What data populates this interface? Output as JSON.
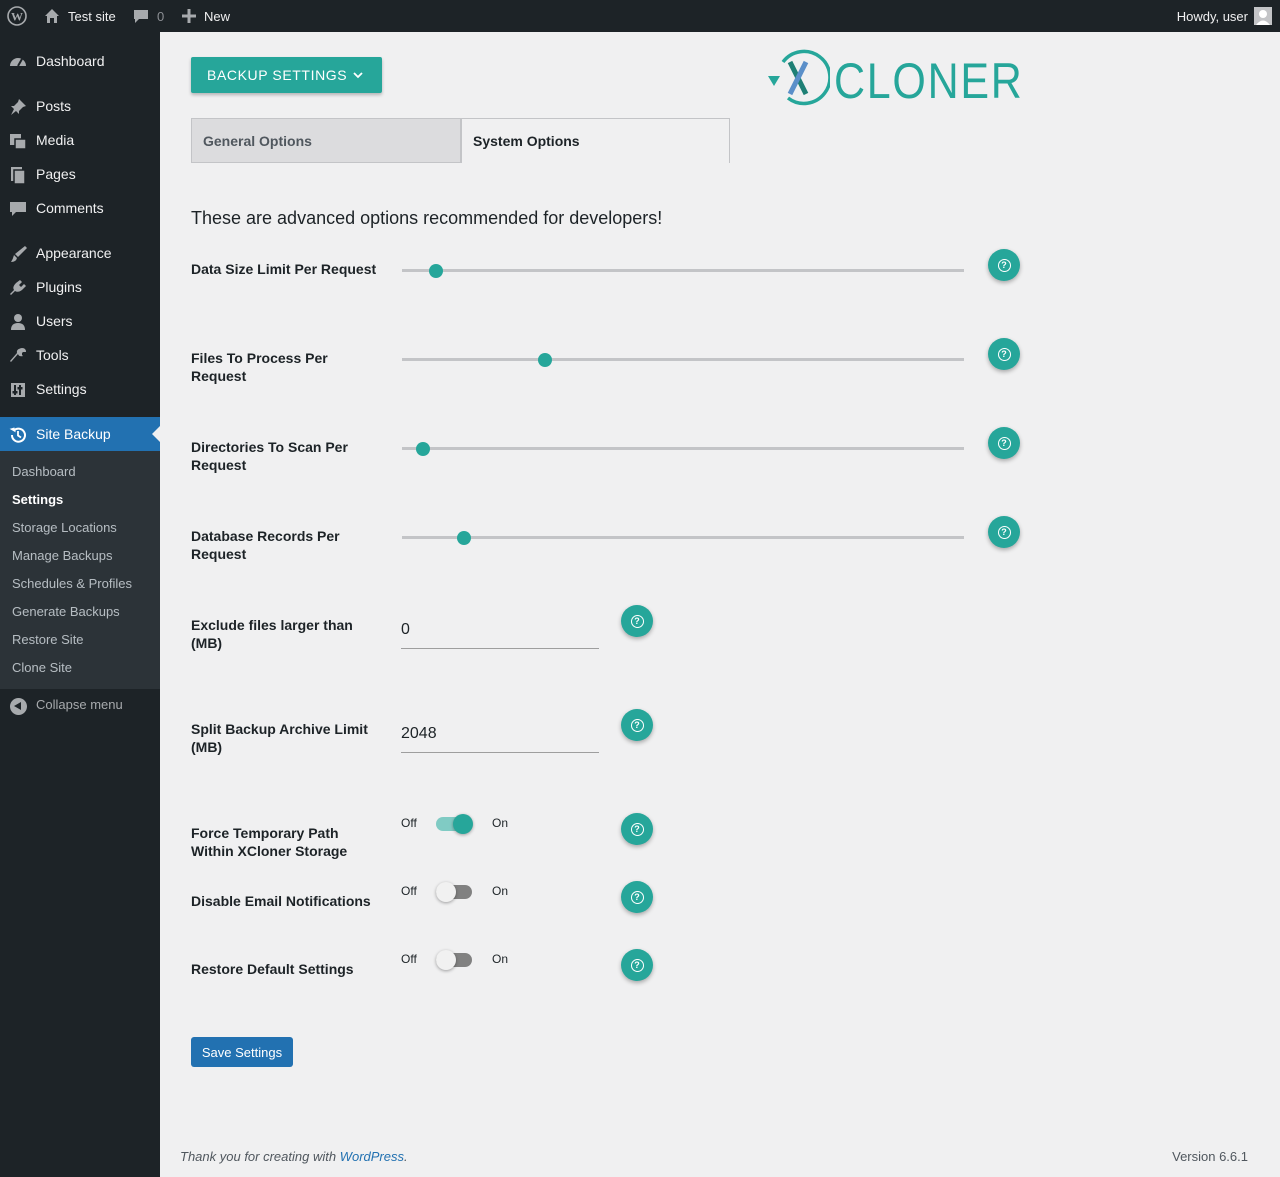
{
  "adminbar": {
    "site_name": "Test site",
    "comments_count": "0",
    "new_label": "New",
    "howdy": "Howdy, user"
  },
  "sidebar": {
    "items": [
      {
        "label": "Dashboard",
        "icon": "dashboard-icon"
      },
      {
        "label": "Posts",
        "icon": "pin-icon"
      },
      {
        "label": "Media",
        "icon": "media-icon"
      },
      {
        "label": "Pages",
        "icon": "pages-icon"
      },
      {
        "label": "Comments",
        "icon": "comments-icon"
      },
      {
        "label": "Appearance",
        "icon": "brush-icon"
      },
      {
        "label": "Plugins",
        "icon": "plug-icon"
      },
      {
        "label": "Users",
        "icon": "user-icon"
      },
      {
        "label": "Tools",
        "icon": "wrench-icon"
      },
      {
        "label": "Settings",
        "icon": "settings-icon"
      },
      {
        "label": "Site Backup",
        "icon": "backup-icon"
      }
    ],
    "submenu": [
      "Dashboard",
      "Settings",
      "Storage Locations",
      "Manage Backups",
      "Schedules & Profiles",
      "Generate Backups",
      "Restore Site",
      "Clone Site"
    ],
    "collapse_label": "Collapse menu"
  },
  "header": {
    "backup_button": "BACKUP SETTINGS",
    "logo_text": "CLONER"
  },
  "tabs": [
    "General Options",
    "System Options"
  ],
  "active_tab": "System Options",
  "intro": "These are advanced options recommended for developers!",
  "sliders": [
    {
      "label": "Data Size Limit Per Request",
      "value_fraction": 0.06
    },
    {
      "label": "Files To Process Per Request",
      "value_fraction": 0.255
    },
    {
      "label": "Directories To Scan Per Request",
      "value_fraction": 0.037
    },
    {
      "label": "Database Records Per Request",
      "value_fraction": 0.11
    }
  ],
  "inputs": [
    {
      "label": "Exclude files larger than (MB)",
      "value": "0"
    },
    {
      "label": "Split Backup Archive Limit (MB)",
      "value": "2048"
    }
  ],
  "switches": [
    {
      "label": "Force Temporary Path Within XCloner Storage",
      "checked": true
    },
    {
      "label": "Disable Email Notifications",
      "checked": false
    },
    {
      "label": "Restore Default Settings",
      "checked": false
    }
  ],
  "switch_off_label": "Off",
  "switch_on_label": "On",
  "save_button": "Save Settings",
  "footer": {
    "thanks_prefix": "Thank you for creating with",
    "wordpress_link": "WordPress",
    "thanks_suffix": ".",
    "version": "Version 6.6.1"
  },
  "colors": {
    "accent": "#26a69a",
    "admin_dark": "#1d2327",
    "primary_blue": "#2271b1"
  }
}
